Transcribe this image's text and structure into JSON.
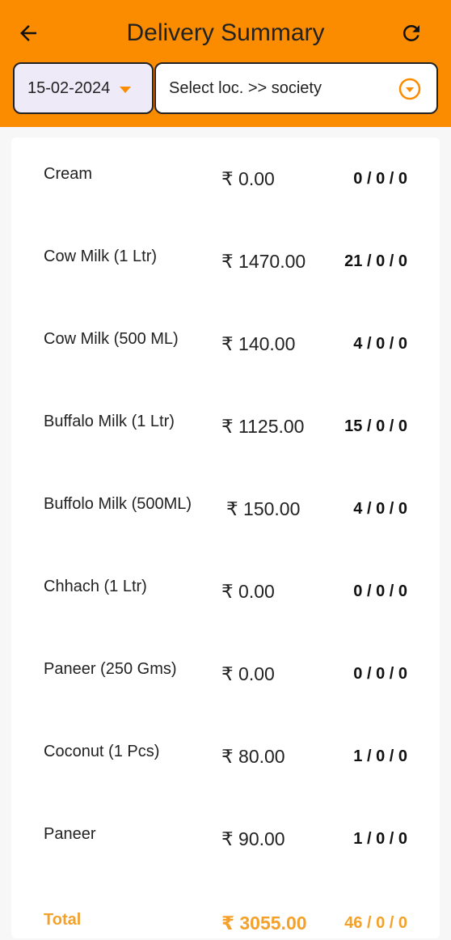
{
  "header": {
    "title": "Delivery Summary",
    "back_icon": "arrow-left-icon",
    "refresh_icon": "refresh-icon",
    "accent_color": "#fb8c00"
  },
  "filters": {
    "date": "15-02-2024",
    "location_placeholder": "Select loc. >> society"
  },
  "items": [
    {
      "name": "Cream",
      "amount": "₹ 0.00",
      "count": "0 / 0 / 0"
    },
    {
      "name": "Cow Milk (1 Ltr)",
      "amount": "₹ 1470.00",
      "count": "21 / 0 / 0"
    },
    {
      "name": "Cow Milk (500 ML)",
      "amount": "₹ 140.00",
      "count": "4 / 0 / 0"
    },
    {
      "name": "Buffalo Milk (1 Ltr)",
      "amount": "₹ 1125.00",
      "count": "15 / 0 / 0"
    },
    {
      "name": "Buffolo Milk (500ML)",
      "amount": "₹ 150.00",
      "count": "4 / 0 / 0"
    },
    {
      "name": "Chhach (1 Ltr)",
      "amount": "₹ 0.00",
      "count": "0 / 0 / 0"
    },
    {
      "name": "Paneer (250 Gms)",
      "amount": "₹ 0.00",
      "count": "0 / 0 / 0"
    },
    {
      "name": "Coconut (1 Pcs)",
      "amount": "₹ 80.00",
      "count": "1 / 0 / 0"
    },
    {
      "name": "Paneer",
      "amount": "₹ 90.00",
      "count": "1 / 0 / 0"
    }
  ],
  "total": {
    "label": "Total",
    "amount": "₹ 3055.00",
    "count": "46 / 0 / 0",
    "color": "#f3a12b"
  }
}
